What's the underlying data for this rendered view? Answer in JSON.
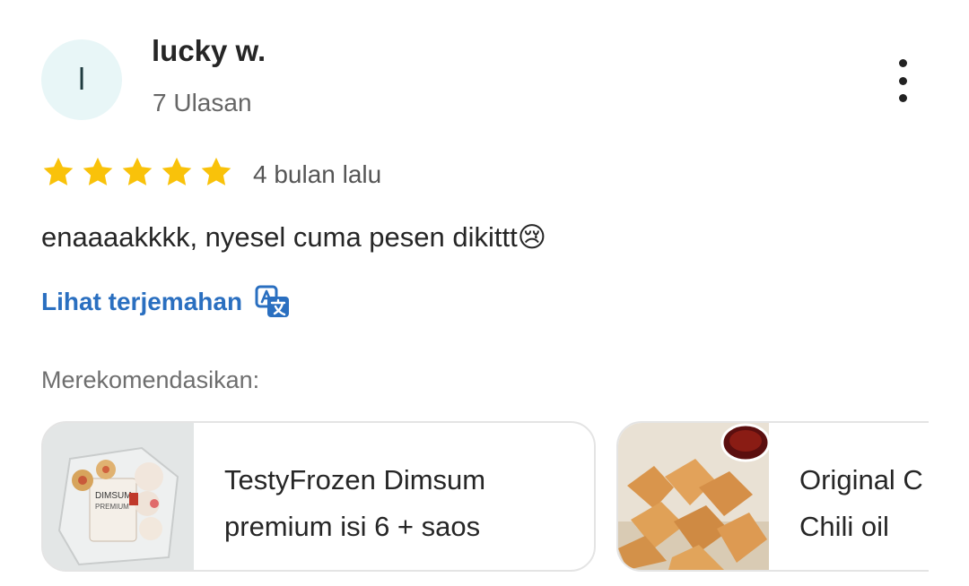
{
  "reviewer": {
    "avatar_initial": "l",
    "name": "lucky w.",
    "review_count": "7 Ulasan"
  },
  "review": {
    "rating": 5,
    "time_ago": "4 bulan lalu",
    "text": "enaaaakkkk, nyesel cuma pesen dikittt😢",
    "translate_link": "Lihat terjemahan"
  },
  "recommendations": {
    "label": "Merekomendasikan:",
    "items": [
      {
        "title_line1": "TestyFrozen Dimsum",
        "title_line2": "premium isi 6 + saos"
      },
      {
        "title_line1": "Original C",
        "title_line2": "Chili oil"
      }
    ]
  },
  "colors": {
    "star": "#f9c20a",
    "link": "#2a6fc0",
    "avatar_bg": "#e8f6f7"
  },
  "icons": [
    "more-vert-icon",
    "star-icon",
    "translate-icon"
  ]
}
